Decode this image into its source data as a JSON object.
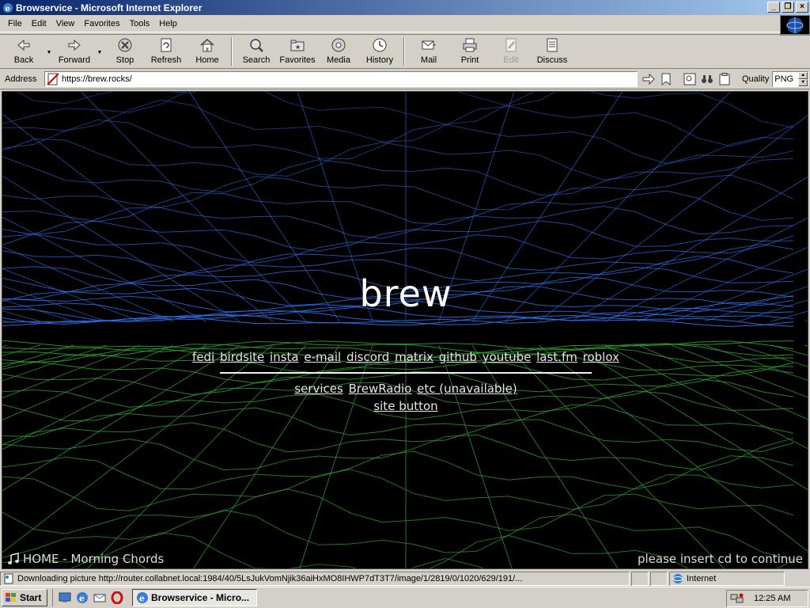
{
  "window": {
    "title": "Browservice - Microsoft Internet Explorer",
    "controls": {
      "minimize": "_",
      "restore": "❐",
      "close": "×"
    }
  },
  "menu": [
    {
      "label": "File"
    },
    {
      "label": "Edit"
    },
    {
      "label": "View"
    },
    {
      "label": "Favorites"
    },
    {
      "label": "Tools"
    },
    {
      "label": "Help"
    }
  ],
  "toolbar": {
    "back": "Back",
    "forward": "Forward",
    "stop": "Stop",
    "refresh": "Refresh",
    "home": "Home",
    "search": "Search",
    "favorites": "Favorites",
    "media": "Media",
    "history": "History",
    "mail": "Mail",
    "print": "Print",
    "edit": "Edit",
    "discuss": "Discuss"
  },
  "address": {
    "label": "Address",
    "url": "https://brew.rocks/",
    "quality_label": "Quality",
    "quality_value": "PNG"
  },
  "page": {
    "title": "brew",
    "links_row1": [
      "fedi",
      "birdsite",
      "insta",
      "e-mail",
      "discord",
      "matrix",
      "github",
      "youtube",
      "last.fm",
      "roblox"
    ],
    "links_row2": [
      "services",
      "BrewRadio",
      "etc (unavailable)"
    ],
    "links_row3": [
      "site button"
    ],
    "now_playing": "HOME - Morning Chords",
    "insert_cd": "please insert cd to continue",
    "colors": {
      "upper_grid": "#2f6fe8",
      "lower_grid": "#2f9e2f",
      "background": "#000000"
    }
  },
  "status": {
    "text": "Downloading picture http://router.collabnet.local:1984/40/5LsJukVomNjik36aiHxMO8IHWP7dT3T7/image/1/2819/0/1020/629/191/...",
    "zone": "Internet"
  },
  "taskbar": {
    "start": "Start",
    "task": "Browservice - Micro...",
    "clock": "12:25 AM"
  }
}
